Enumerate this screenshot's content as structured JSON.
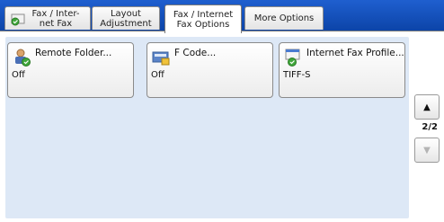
{
  "tabs": [
    {
      "label": "Fax / Inter-\nnet Fax",
      "active": false,
      "icon": "fax-home-icon"
    },
    {
      "label": "Layout\nAdjustment",
      "active": false
    },
    {
      "label": "Fax / Internet\nFax Options",
      "active": true
    },
    {
      "label": "More Options",
      "active": false
    }
  ],
  "features": [
    {
      "title": "Remote Folder...",
      "value": "Off",
      "icon": "remote-folder-icon"
    },
    {
      "title": "F Code...",
      "value": "Off",
      "icon": "f-code-icon"
    },
    {
      "title": "Internet Fax Profile...",
      "value": "TIFF-S",
      "icon": "internet-fax-profile-icon"
    }
  ],
  "pagination": {
    "indicator": "2/2",
    "up": "▲",
    "down": "▼"
  },
  "colors": {
    "tab_bar": "#1a55c0",
    "panel": "#dde8f6",
    "accent_green": "#3fa63a"
  }
}
